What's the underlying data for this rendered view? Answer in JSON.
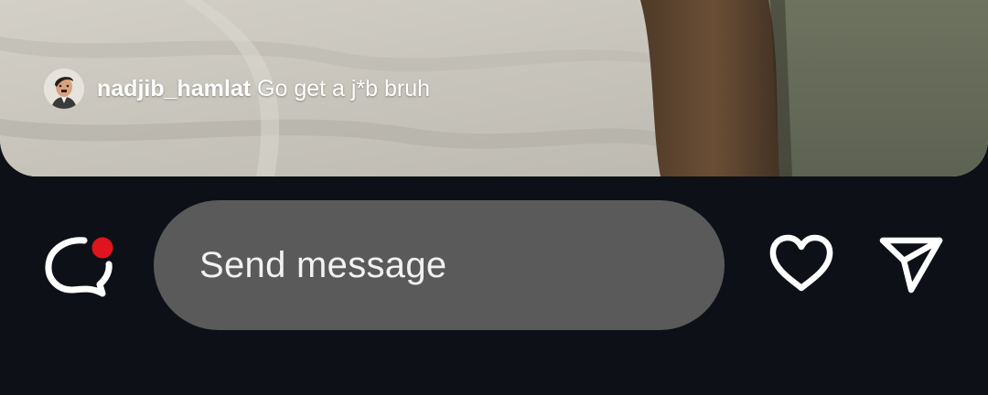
{
  "comment": {
    "username": "nadjib_hamlat",
    "text": "Go get a j*b bruh"
  },
  "composer": {
    "placeholder": "Send message"
  },
  "icons": {
    "comments": "chat-bubble-icon",
    "notification": "notification-dot",
    "like": "heart-icon",
    "share": "paper-plane-icon"
  },
  "colors": {
    "background": "#0d1117",
    "field": "#5a5a5a",
    "notification_dot": "#e0141e",
    "icon": "#ffffff"
  }
}
